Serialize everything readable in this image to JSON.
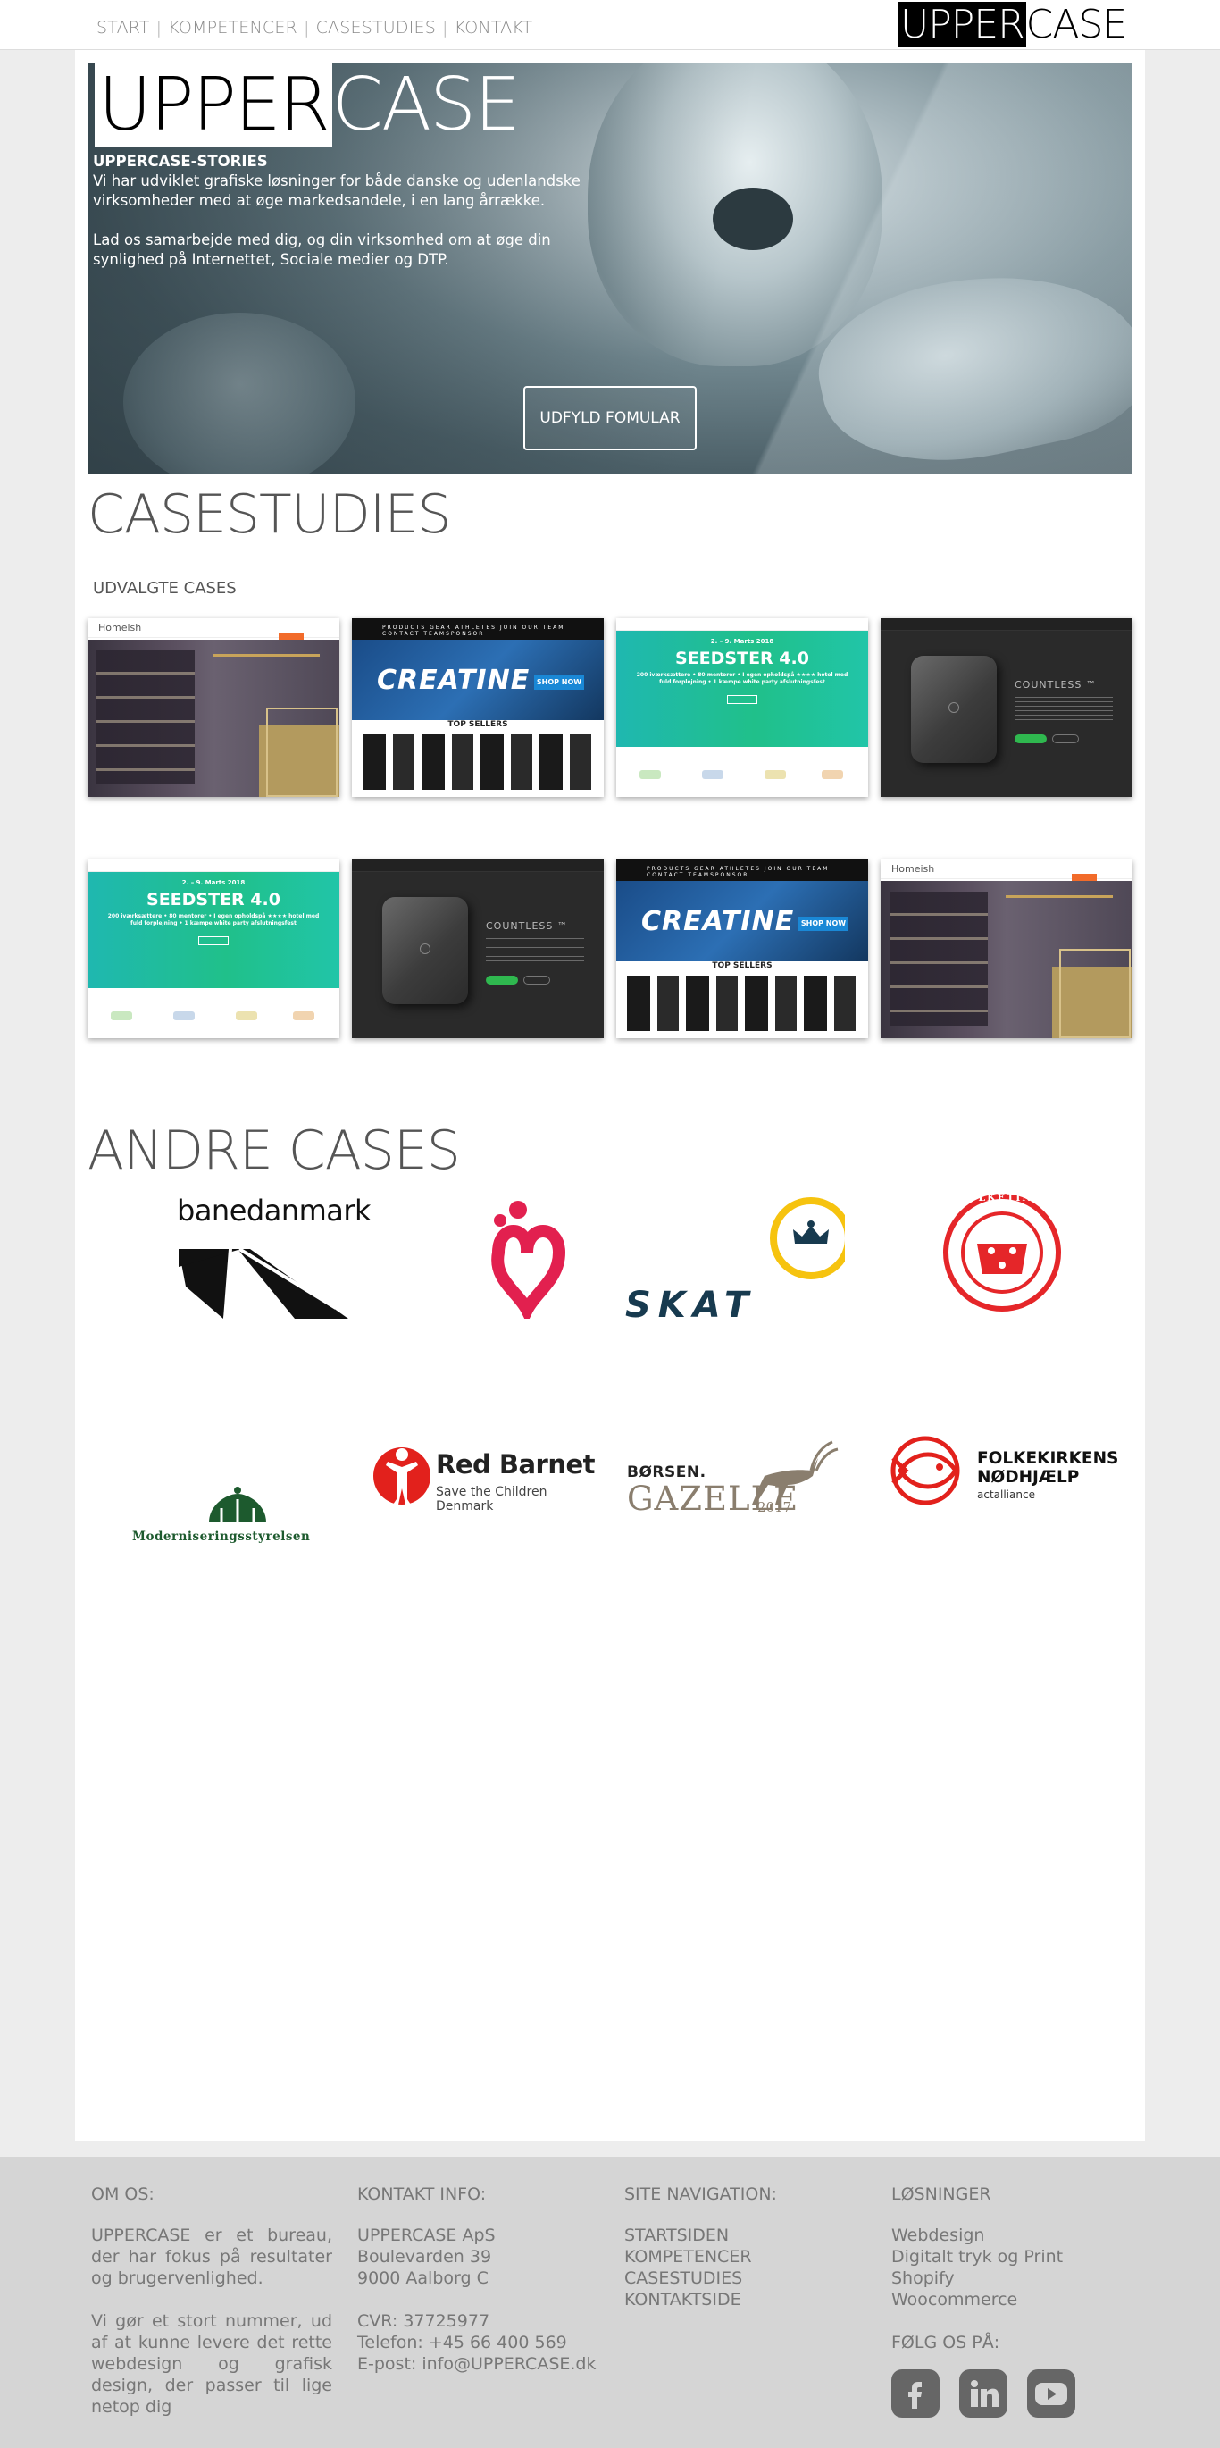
{
  "nav": {
    "items": [
      "START",
      "KOMPETENCER",
      "CASESTUDIES",
      "KONTAKT"
    ],
    "separator": "|"
  },
  "logo": {
    "upper": "UPPER",
    "case": "CASE"
  },
  "hero": {
    "logo_upper": "UPPER",
    "logo_case": "CASE",
    "title": "UPPERCASE-STORIES",
    "paragraph1": "Vi har udviklet  grafiske løsninger for både danske og udenlandske virksomheder med at øge markedsandele, i en lang årrække.",
    "paragraph2": "Lad os samarbejde med dig, og din virksomhed om at øge din synlighed på Internettet, Sociale medier og DTP.",
    "button": "UDFYLD FOMULAR"
  },
  "casestudies": {
    "heading": "CASESTUDIES",
    "subheading": "UDVALGTE CASES",
    "thumbs": {
      "homeish_brand": "Homeish",
      "creatine_nav": "PRODUCTS   GEAR   ATHLETES   JOIN OUR TEAM   CONTACT   TEAMSPONSOR",
      "creatine_title": "CREATINE",
      "creatine_shop": "SHOP NOW",
      "creatine_top": "TOP SELLERS",
      "seed_date": "2. – 9. Marts 2018",
      "seed_title": "SEEDSTER 4.0",
      "seed_line": "200 iværksættere • 80 mentorer • I egen opholdspå ★★★★ hotel med fuld forplejning • 1 kæmpe white party afslutningsfest",
      "count_title": "COUNTLESS ™"
    }
  },
  "andre": {
    "heading": "ANDRE CASES",
    "logos": {
      "banedanmark": "banedanmark",
      "skat": "SKAT",
      "folketinget": "FOLKETINGET",
      "moderniseringsstyrelsen": "Moderniseringsstyrelsen",
      "redbarnet": "Red Barnet",
      "redbarnet_sub": "Save the Children Denmark",
      "borsen": "BØRSEN.",
      "gazelle": "GAZELLE",
      "gazelle_year": "2017",
      "fn_line1": "FOLKEKIRKENS",
      "fn_line2": "NØDHJÆLP",
      "fn_sub": "actalliance"
    }
  },
  "footer": {
    "om": {
      "heading": "OM OS:",
      "p1": "UPPERCASE er et bureau, der har fokus på resultater og brugervenlighed.",
      "p2": "Vi gør et stort nummer, ud af at kunne levere det rette webdesign og grafisk design, der passer til lige netop dig"
    },
    "kontakt": {
      "heading": "KONTAKT INFO:",
      "company": "UPPERCASE ApS",
      "street": "Boulevarden 39",
      "city": "9000 Aalborg C",
      "cvr": "CVR: 37725977",
      "phone": "Telefon: +45 66 400 569",
      "email": "E-post: info@UPPERCASE.dk"
    },
    "site": {
      "heading": "SITE NAVIGATION:",
      "links": [
        "STARTSIDEN",
        "KOMPETENCER",
        "CASESTUDIES",
        "KONTAKTSIDE"
      ]
    },
    "losninger": {
      "heading": "LØSNINGER",
      "items": [
        "Webdesign",
        "Digitalt tryk og Print",
        "Shopify",
        "Woocommerce"
      ],
      "follow": "FØLG OS PÅ:"
    },
    "social_icons": [
      "facebook-icon",
      "linkedin-icon",
      "youtube-icon"
    ]
  }
}
